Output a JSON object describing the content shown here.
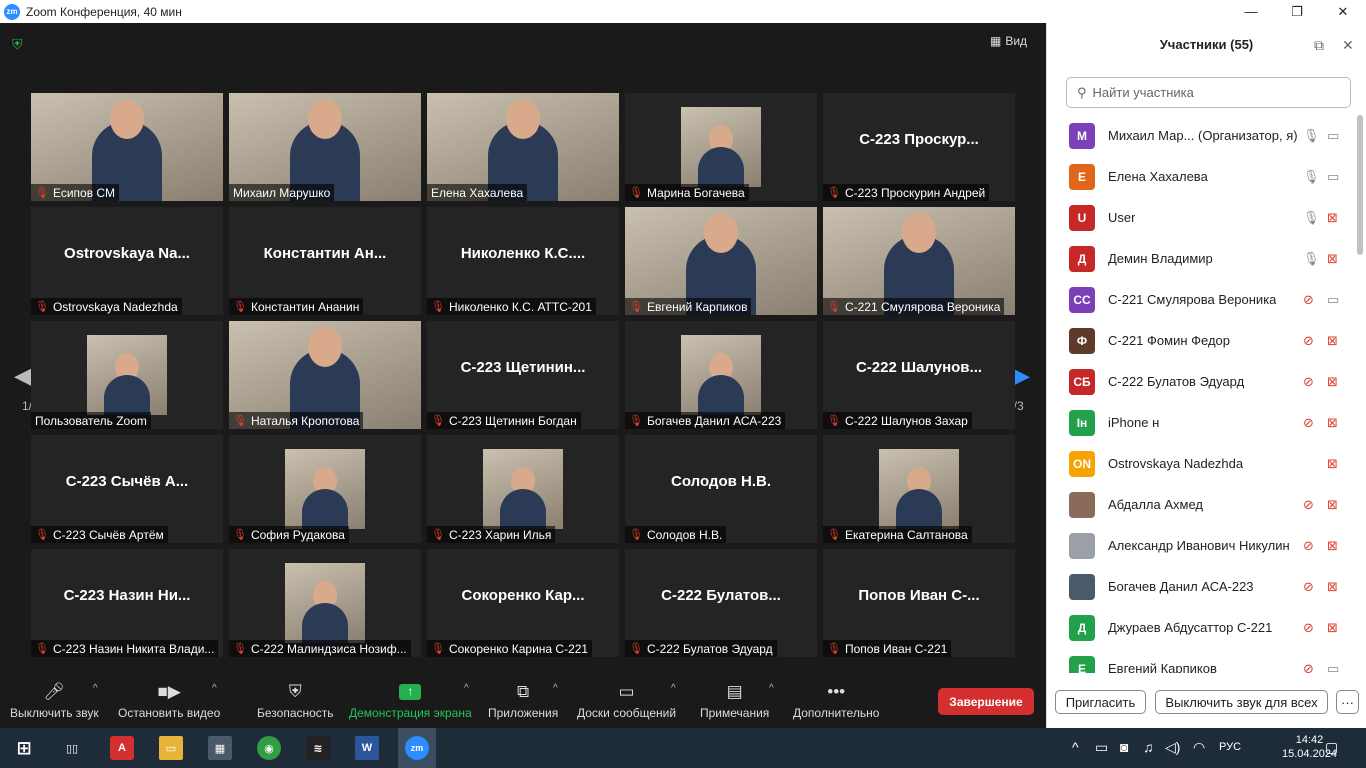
{
  "window": {
    "title": "Zoom Конференция, 40 мин",
    "logo": "zm"
  },
  "view_button": "Вид",
  "page_indicator": "1/3",
  "tiles": [
    {
      "label": "Есипов СМ",
      "big": "",
      "kind": "video"
    },
    {
      "label": "Михаил Марушко",
      "big": "",
      "kind": "video"
    },
    {
      "label": "Елена Хахалева",
      "big": "",
      "kind": "video-active"
    },
    {
      "label": "Марина Богачева",
      "big": "",
      "kind": "thumb"
    },
    {
      "label": "С-223 Проскурин Андрей",
      "big": "С-223 Проскур...",
      "kind": "name"
    },
    {
      "label": "Ostrovskaya Nadezhda",
      "big": "Ostrovskaya Na...",
      "kind": "name"
    },
    {
      "label": "Константин Ананин",
      "big": "Константин Ан...",
      "kind": "name"
    },
    {
      "label": "Николенко К.С. АТТС-201",
      "big": "Николенко К.С....",
      "kind": "name"
    },
    {
      "label": "Евгений Карпиков",
      "big": "",
      "kind": "video"
    },
    {
      "label": "С-221 Смулярова Вероника",
      "big": "",
      "kind": "video"
    },
    {
      "label": "Пользователь Zoom",
      "big": "",
      "kind": "thumb"
    },
    {
      "label": "Наталья Кропотова",
      "big": "",
      "kind": "video"
    },
    {
      "label": "С-223 Щетинин Богдан",
      "big": "С-223 Щетинин...",
      "kind": "name"
    },
    {
      "label": "Богачев Данил АСА-223",
      "big": "",
      "kind": "thumb"
    },
    {
      "label": "С-222 Шалунов Захар",
      "big": "С-222 Шалунов...",
      "kind": "name"
    },
    {
      "label": "С-223 Сычёв Артём",
      "big": "С-223 Сычёв А...",
      "kind": "name"
    },
    {
      "label": "София Рудакова",
      "big": "",
      "kind": "thumb"
    },
    {
      "label": "С-223 Харин Илья",
      "big": "",
      "kind": "thumb"
    },
    {
      "label": "Солодов Н.В.",
      "big": "Солодов Н.В.",
      "kind": "name"
    },
    {
      "label": "Екатерина Салтанова",
      "big": "",
      "kind": "thumb"
    },
    {
      "label": "С-223 Назин Никита Влади...",
      "big": "С-223 Назин Ни...",
      "kind": "name"
    },
    {
      "label": "С-222 Малиндзиса Нозиф...",
      "big": "",
      "kind": "thumb"
    },
    {
      "label": "Сокоренко Карина С-221",
      "big": "Сокоренко Кар...",
      "kind": "name"
    },
    {
      "label": "С-222 Булатов Эдуард",
      "big": "С-222 Булатов...",
      "kind": "name"
    },
    {
      "label": "Попов Иван С-221",
      "big": "Попов Иван С-...",
      "kind": "name"
    }
  ],
  "toolbar": {
    "mute": "Выключить звук",
    "stop_video": "Остановить видео",
    "security": "Безопасность",
    "share": "Демонстрация экрана",
    "apps": "Приложения",
    "whiteboards": "Доски сообщений",
    "notes": "Примечания",
    "more": "Дополнительно",
    "end": "Завершение"
  },
  "panel": {
    "title": "Участники (55)",
    "search_placeholder": "Найти участника",
    "invite": "Пригласить",
    "mute_all": "Выключить звук для всех",
    "participants": [
      {
        "initials": "M",
        "color": "#7b3fb8",
        "name": "Михаил Мар... (Организатор, я)",
        "mic": "on",
        "cam": "on"
      },
      {
        "initials": "E",
        "color": "#e0661a",
        "name": "Елена Хахалева",
        "mic": "on",
        "cam": "on"
      },
      {
        "initials": "U",
        "color": "#c62828",
        "name": "User",
        "mic": "on",
        "cam": "off"
      },
      {
        "initials": "Д",
        "color": "#c62828",
        "name": "Демин Владимир",
        "mic": "on",
        "cam": "off"
      },
      {
        "initials": "СС",
        "color": "#7b3fb8",
        "name": "С-221 Смулярова Вероника",
        "mic": "off",
        "cam": "on"
      },
      {
        "initials": "Ф",
        "color": "#5d3a2a",
        "name": "С-221 Фомин Федор",
        "mic": "off",
        "cam": "off"
      },
      {
        "initials": "СБ",
        "color": "#c62828",
        "name": "С-222 Булатов Эдуард",
        "mic": "off",
        "cam": "off"
      },
      {
        "initials": "Ін",
        "color": "#22a04a",
        "name": "iPhone н",
        "mic": "off",
        "cam": "off"
      },
      {
        "initials": "ON",
        "color": "#f5a300",
        "name": "Ostrovskaya Nadezhda",
        "mic": "none",
        "cam": "off"
      },
      {
        "initials": "",
        "color": "#8a6b5a",
        "name": "Абдалла Ахмед",
        "mic": "off",
        "cam": "off"
      },
      {
        "initials": "",
        "color": "#9aa0a6",
        "name": "Александр Иванович Никулин",
        "mic": "off",
        "cam": "off"
      },
      {
        "initials": "",
        "color": "#4a5a6a",
        "name": "Богачев Данил АСА-223",
        "mic": "off",
        "cam": "off"
      },
      {
        "initials": "Д",
        "color": "#22a04a",
        "name": "Джураев Абдусаттор С-221",
        "mic": "off",
        "cam": "off"
      },
      {
        "initials": "E",
        "color": "#22a04a",
        "name": "Евгений Карпиков",
        "mic": "off",
        "cam": "on"
      }
    ]
  },
  "taskbar": {
    "time": "14:42",
    "date": "15.04.2024",
    "lang": "РУС"
  }
}
